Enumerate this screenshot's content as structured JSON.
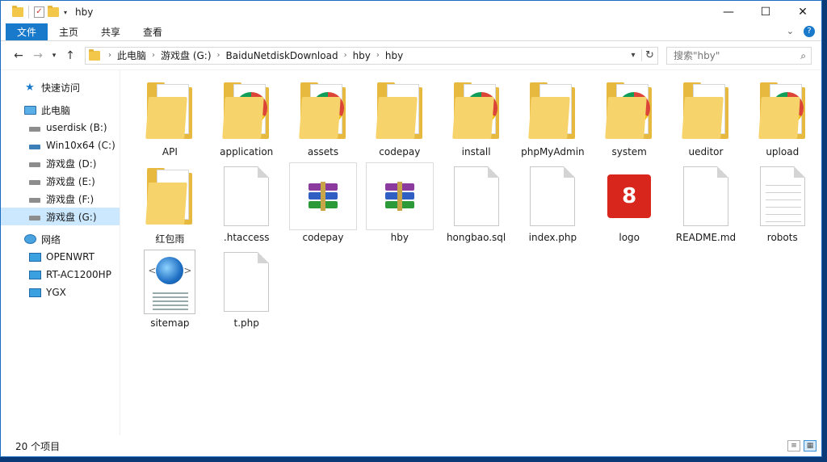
{
  "window": {
    "title": "hby"
  },
  "ribbon": {
    "tabs": [
      "文件",
      "主页",
      "共享",
      "查看"
    ]
  },
  "navigation": {
    "breadcrumb": [
      "此电脑",
      "游戏盘 (G:)",
      "BaiduNetdiskDownload",
      "hby",
      "hby"
    ],
    "search_placeholder": "搜索\"hby\""
  },
  "sidebar": {
    "quick_access": "快速访问",
    "this_pc": "此电脑",
    "drives": [
      {
        "label": "userdisk (B:)",
        "icon": "drive-icon"
      },
      {
        "label": "Win10x64 (C:)",
        "icon": "system-drive-icon"
      },
      {
        "label": "游戏盘 (D:)",
        "icon": "drive-icon"
      },
      {
        "label": "游戏盘 (E:)",
        "icon": "drive-icon"
      },
      {
        "label": "游戏盘 (F:)",
        "icon": "drive-icon"
      },
      {
        "label": "游戏盘 (G:)",
        "icon": "drive-icon",
        "selected": true
      }
    ],
    "network": "网络",
    "network_items": [
      "OPENWRT",
      "RT-AC1200HP",
      "YGX"
    ]
  },
  "files": [
    {
      "name": "API",
      "type": "folder"
    },
    {
      "name": "application",
      "type": "folder-chrome"
    },
    {
      "name": "assets",
      "type": "folder-chrome"
    },
    {
      "name": "codepay",
      "type": "folder"
    },
    {
      "name": "install",
      "type": "folder-chrome"
    },
    {
      "name": "phpMyAdmin",
      "type": "folder"
    },
    {
      "name": "system",
      "type": "folder-chrome"
    },
    {
      "name": "ueditor",
      "type": "folder-docs"
    },
    {
      "name": "upload",
      "type": "folder-chrome"
    },
    {
      "name": "红包雨",
      "type": "folder-docs"
    },
    {
      "name": ".htaccess",
      "type": "file"
    },
    {
      "name": "codepay",
      "type": "rar"
    },
    {
      "name": "hby",
      "type": "rar"
    },
    {
      "name": "hongbao.sql",
      "type": "file"
    },
    {
      "name": "index.php",
      "type": "file"
    },
    {
      "name": "logo",
      "type": "logo",
      "glyph": "8"
    },
    {
      "name": "README.md",
      "type": "file"
    },
    {
      "name": "robots",
      "type": "text"
    },
    {
      "name": "sitemap",
      "type": "sitemap"
    },
    {
      "name": "t.php",
      "type": "file"
    }
  ],
  "status": {
    "item_count": "20 个项目"
  },
  "colors": {
    "accent": "#1979ca",
    "selection": "#cce8ff",
    "folder": "#f6d36b"
  }
}
